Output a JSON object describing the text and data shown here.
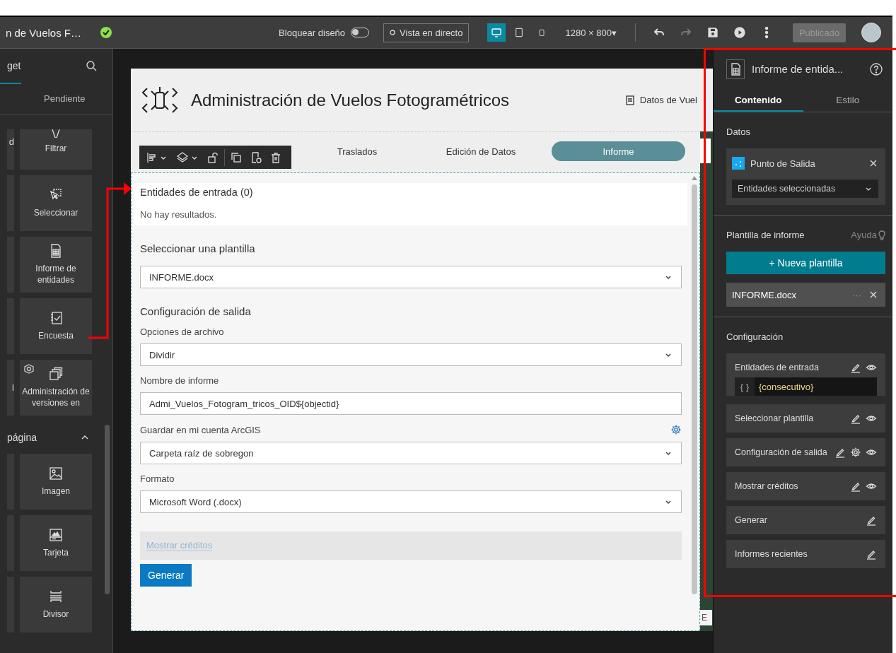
{
  "top_bar": {
    "app_title": "n de Vuelos F…",
    "lock_layout": {
      "label": "Bloquear diseño",
      "on": false
    },
    "live_view": "Vista en directo",
    "devices": [
      {
        "kind": "desktop",
        "selected": true
      },
      {
        "kind": "tablet",
        "selected": false
      },
      {
        "kind": "phone",
        "selected": false
      }
    ],
    "resolution": "1280 × 800▾",
    "actions": [
      {
        "kind": "undo",
        "disabled": false
      },
      {
        "kind": "redo",
        "disabled": true
      },
      {
        "kind": "save",
        "disabled": false
      },
      {
        "kind": "preview",
        "disabled": false
      },
      {
        "kind": "more",
        "disabled": false
      }
    ],
    "publish": {
      "label": "Publicado",
      "disabled": true
    }
  },
  "widget_panel": {
    "title": "get",
    "tab": "Pendiente",
    "groups": [
      {
        "tiles": [
          {
            "kind": "filter",
            "label": "Filtrar",
            "left_fragment": "d"
          },
          {
            "kind": "select",
            "label": "Seleccionar"
          },
          {
            "kind": "report",
            "label": "Informe de entidades"
          },
          {
            "kind": "survey",
            "label": "Encuesta"
          },
          {
            "kind": "versions",
            "label": "Administración de versiones en",
            "left_fragment": "l"
          }
        ]
      },
      {
        "title": "página",
        "expanded": true,
        "tiles": [
          {
            "kind": "image",
            "label": "Imagen"
          },
          {
            "kind": "card",
            "label": "Tarjeta"
          },
          {
            "kind": "divider",
            "label": "Divisor"
          }
        ]
      }
    ]
  },
  "canvas": {
    "page": {
      "title": "Administración de Vuelos Fotogramétricos",
      "header_link": "Datos de Vuel",
      "nav": [
        {
          "label": "Traslados",
          "selected": false
        },
        {
          "label": "Edición de Datos",
          "selected": false
        },
        {
          "label": "Informe",
          "selected": true
        }
      ],
      "map_label": "E",
      "report_widget": {
        "input_title": "Entidades de entrada (0)",
        "empty_message": "No hay resultados.",
        "template_heading": "Seleccionar una plantilla",
        "template": "INFORME.docx",
        "output_heading": "Configuración de salida",
        "fields": [
          {
            "kind": "select",
            "label": "Opciones de archivo",
            "value": "Dividir"
          },
          {
            "kind": "text",
            "label": "Nombre de informe",
            "value": "Admi_Vuelos_Fotogram_tricos_OID${objectid}"
          },
          {
            "kind": "select",
            "label": "Guardar en mi cuenta ArcGIS",
            "value": "Carpeta raíz de sobregon",
            "settings": true
          },
          {
            "kind": "select",
            "label": "Formato",
            "value": "Microsoft Word (.docx)"
          }
        ],
        "credits_link": "Mostrar créditos",
        "generate_button": "Generar"
      }
    }
  },
  "settings_panel": {
    "title": "Informe de entida...",
    "tabs": [
      {
        "label": "Contenido",
        "selected": true
      },
      {
        "label": "Estilo",
        "selected": false
      }
    ],
    "data": {
      "heading": "Datos",
      "source": "Punto de Salida",
      "filter": "Entidades seleccionadas"
    },
    "template": {
      "heading": "Plantilla de informe",
      "help": "Ayuda",
      "new_button": "+ Nueva plantilla",
      "files": [
        {
          "name": "INFORME.docx",
          "menu": "···"
        }
      ]
    },
    "configuration": {
      "heading": "Configuración",
      "items": [
        {
          "label": "Entidades de entrada",
          "editable": true,
          "visibility_toggle": true,
          "expression_prefix": "{ }",
          "expression": "{consecutivo}"
        },
        {
          "label": "Seleccionar plantilla",
          "editable": true,
          "visibility_toggle": true
        },
        {
          "label": "Configuración de salida",
          "editable": true,
          "settings": true,
          "visibility_toggle": true
        },
        {
          "label": "Mostrar créditos",
          "editable": true,
          "visibility_toggle": true
        },
        {
          "label": "Generar",
          "editable": true
        },
        {
          "label": "Informes recientes",
          "editable": true
        }
      ]
    }
  }
}
